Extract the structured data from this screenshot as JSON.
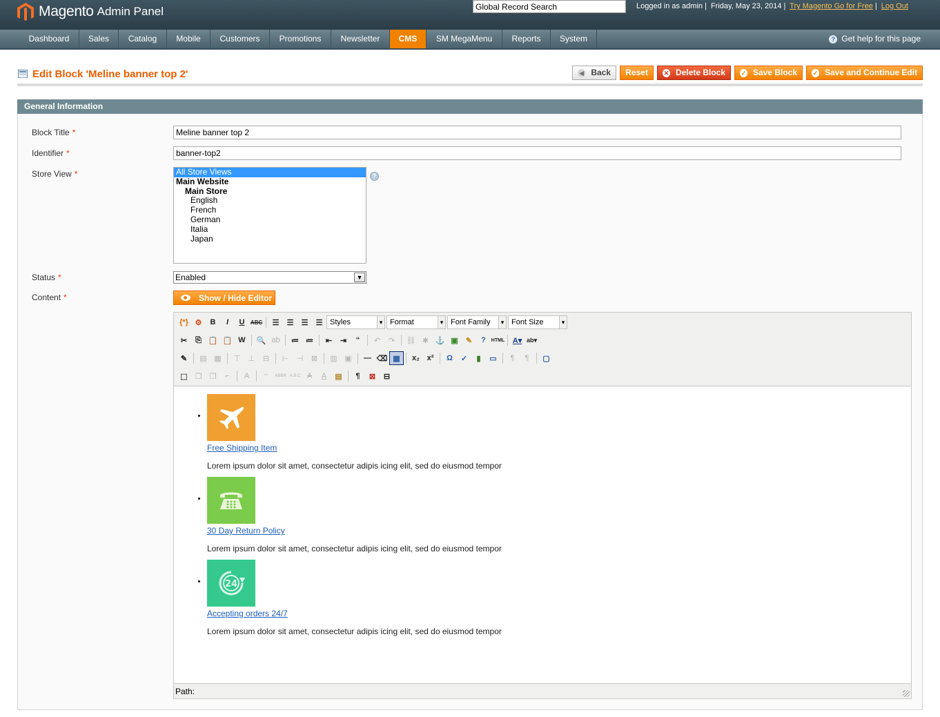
{
  "header": {
    "brand": "Magento",
    "brand_sub": "Admin Panel",
    "search_value": "Global Record Search",
    "logged_in": "Logged in as admin",
    "date": "Friday, May 23, 2014",
    "try_link": "Try Magento Go for Free",
    "logout_link": "Log Out"
  },
  "nav": {
    "items": [
      "Dashboard",
      "Sales",
      "Catalog",
      "Mobile",
      "Customers",
      "Promotions",
      "Newsletter",
      "CMS",
      "SM MegaMenu",
      "Reports",
      "System"
    ],
    "active": "CMS",
    "help": "Get help for this page"
  },
  "page": {
    "title": "Edit Block 'Meline banner top 2'",
    "buttons": {
      "back": "Back",
      "reset": "Reset",
      "delete": "Delete Block",
      "save": "Save Block",
      "save_continue": "Save and Continue Edit"
    }
  },
  "form": {
    "section_title": "General Information",
    "block_title_label": "Block Title",
    "block_title_value": "Meline banner top 2",
    "identifier_label": "Identifier",
    "identifier_value": "banner-top2",
    "store_view_label": "Store View",
    "store_options": {
      "all": "All Store Views",
      "website": "Main Website",
      "store": "Main Store",
      "views": [
        "English",
        "French",
        "German",
        "Italia",
        "Japan"
      ]
    },
    "status_label": "Status",
    "status_value": "Enabled",
    "content_label": "Content",
    "show_hide_editor": "Show / Hide Editor",
    "required_mark": "*"
  },
  "editor": {
    "dropdowns": [
      "Styles",
      "Format",
      "Font Family",
      "Font Size"
    ],
    "path_label": "Path:",
    "features": [
      {
        "title": "Free Shipping Item",
        "desc": "Lorem ipsum dolor sit amet, consectetur adipis icing elit, sed do eiusmod tempor",
        "color": "#f0a030",
        "icon": "airplane-icon"
      },
      {
        "title": "30 Day Return Policy",
        "desc": "Lorem ipsum dolor sit amet, consectetur adipis icing elit, sed do eiusmod tempor",
        "color": "#7ccc4c",
        "icon": "telephone-icon"
      },
      {
        "title": "Accepting orders 24/7",
        "desc": "Lorem ipsum dolor sit amet, consectetur adipis icing elit, sed do eiusmod tempor",
        "color": "#35c98e",
        "icon": "24-hours-icon"
      }
    ],
    "tile_24_text": "24"
  },
  "colors": {
    "accent": "#f18200",
    "header": "#2b3d47",
    "nav": "#5a7380",
    "section_head": "#6f8992",
    "title": "#eb5e00"
  }
}
